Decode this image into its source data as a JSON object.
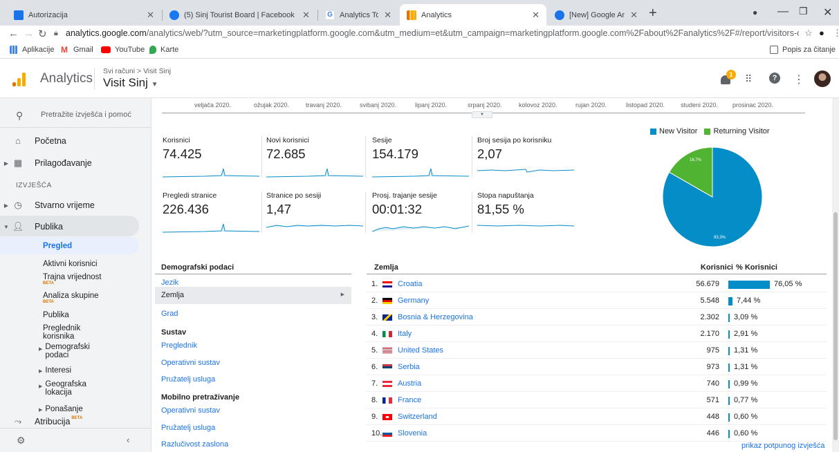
{
  "browser": {
    "tabs": [
      {
        "title": "Autorizacija",
        "active": false
      },
      {
        "title": "(5) Sinj Tourist Board | Facebook",
        "active": false
      },
      {
        "title": "Analytics Tools & Solutions for Y",
        "active": false
      },
      {
        "title": "Analytics",
        "active": true
      },
      {
        "title": "[New] Google Analytics Acquisiti",
        "active": false
      }
    ],
    "new_tab": "+",
    "url_host": "analytics.google.com",
    "url_rest": "/analytics/web/?utm_source=marketingplatform.google.com&utm_medium=et&utm_campaign=marketingplatform.google.com%2Fabout%2Fanalytics%2F#/report/visitors-overview/a...",
    "bookmarks": [
      "Aplikacije",
      "Gmail",
      "YouTube",
      "Karte"
    ],
    "reading_list": "Popis za čitanje"
  },
  "header": {
    "brand": "Analytics",
    "breadcrumb": "Svi računi > Visit Sinj",
    "property": "Visit Sinj",
    "notification_count": "1"
  },
  "sidebar": {
    "search_placeholder": "Pretražite izvješća i pomoć",
    "home": "Početna",
    "customize": "Prilagođavanje",
    "reports_section": "IZVJEŠĆA",
    "realtime": "Stvarno vrijeme",
    "audience": "Publika",
    "overview": "Pregled",
    "active_users": "Aktivni korisnici",
    "lifetime_value": "Trajna vrijednost",
    "cohort": "Analiza skupine",
    "audiences": "Publika",
    "user_explorer": "Preglednik korisnika",
    "demographics": "Demografski podaci",
    "interests": "Interesi",
    "geo": "Geografska lokacija",
    "behavior": "Ponašanje",
    "attribution": "Atribucija",
    "beta": "BETA"
  },
  "timeline": {
    "months": [
      "veljača 2020.",
      "ožujak 2020.",
      "travanj 2020.",
      "svibanj 2020.",
      "lipanj 2020.",
      "srpanj 2020.",
      "kolovoz 2020.",
      "rujan 2020.",
      "listopad 2020.",
      "studeni 2020.",
      "prosinac 2020."
    ]
  },
  "metrics": [
    {
      "label": "Korisnici",
      "value": "74.425"
    },
    {
      "label": "Novi korisnici",
      "value": "72.685"
    },
    {
      "label": "Sesije",
      "value": "154.179"
    },
    {
      "label": "Broj sesija po korisniku",
      "value": "2,07"
    },
    {
      "label": "Pregledi stranice",
      "value": "226.436"
    },
    {
      "label": "Stranice po sesiji",
      "value": "1,47"
    },
    {
      "label": "Prosj. trajanje sesije",
      "value": "00:01:32"
    },
    {
      "label": "Stopa napuštanja",
      "value": "81,55 %"
    }
  ],
  "pie": {
    "legend": [
      "New Visitor",
      "Returning Visitor"
    ],
    "colors": {
      "new": "#058dc7",
      "returning": "#50b432"
    },
    "new_pct": 83.3,
    "returning_pct": 16.7,
    "new_label": "83,3%",
    "returning_label": "16,7%"
  },
  "demographics": {
    "header": "Demografski podaci",
    "language": "Jezik",
    "country": "Zemlja",
    "city": "Grad",
    "system_header": "Sustav",
    "browser": "Preglednik",
    "os": "Operativni sustav",
    "isp": "Pružatelj usluga",
    "mobile_header": "Mobilno pretraživanje",
    "mobile_os": "Operativni sustav",
    "mobile_isp": "Pružatelj usluga",
    "resolution": "Razlučivost zaslona"
  },
  "countries": {
    "col_country": "Zemlja",
    "col_users": "Korisnici",
    "col_pct": "% Korisnici",
    "rows": [
      {
        "rank": "1.",
        "name": "Croatia",
        "users": "56.679",
        "pct": "76,05 %",
        "pct_value": 76.05
      },
      {
        "rank": "2.",
        "name": "Germany",
        "users": "5.548",
        "pct": "7,44 %",
        "pct_value": 7.44
      },
      {
        "rank": "3.",
        "name": "Bosnia & Herzegovina",
        "users": "2.302",
        "pct": "3,09 %",
        "pct_value": 3.09
      },
      {
        "rank": "4.",
        "name": "Italy",
        "users": "2.170",
        "pct": "2,91 %",
        "pct_value": 2.91
      },
      {
        "rank": "5.",
        "name": "United States",
        "users": "975",
        "pct": "1,31 %",
        "pct_value": 1.31
      },
      {
        "rank": "6.",
        "name": "Serbia",
        "users": "973",
        "pct": "1,31 %",
        "pct_value": 1.31
      },
      {
        "rank": "7.",
        "name": "Austria",
        "users": "740",
        "pct": "0,99 %",
        "pct_value": 0.99
      },
      {
        "rank": "8.",
        "name": "France",
        "users": "571",
        "pct": "0,77 %",
        "pct_value": 0.77
      },
      {
        "rank": "9.",
        "name": "Switzerland",
        "users": "448",
        "pct": "0,60 %",
        "pct_value": 0.6
      },
      {
        "rank": "10.",
        "name": "Slovenia",
        "users": "446",
        "pct": "0,60 %",
        "pct_value": 0.6
      }
    ],
    "full_report": "prikaz potpunog izvješća"
  }
}
